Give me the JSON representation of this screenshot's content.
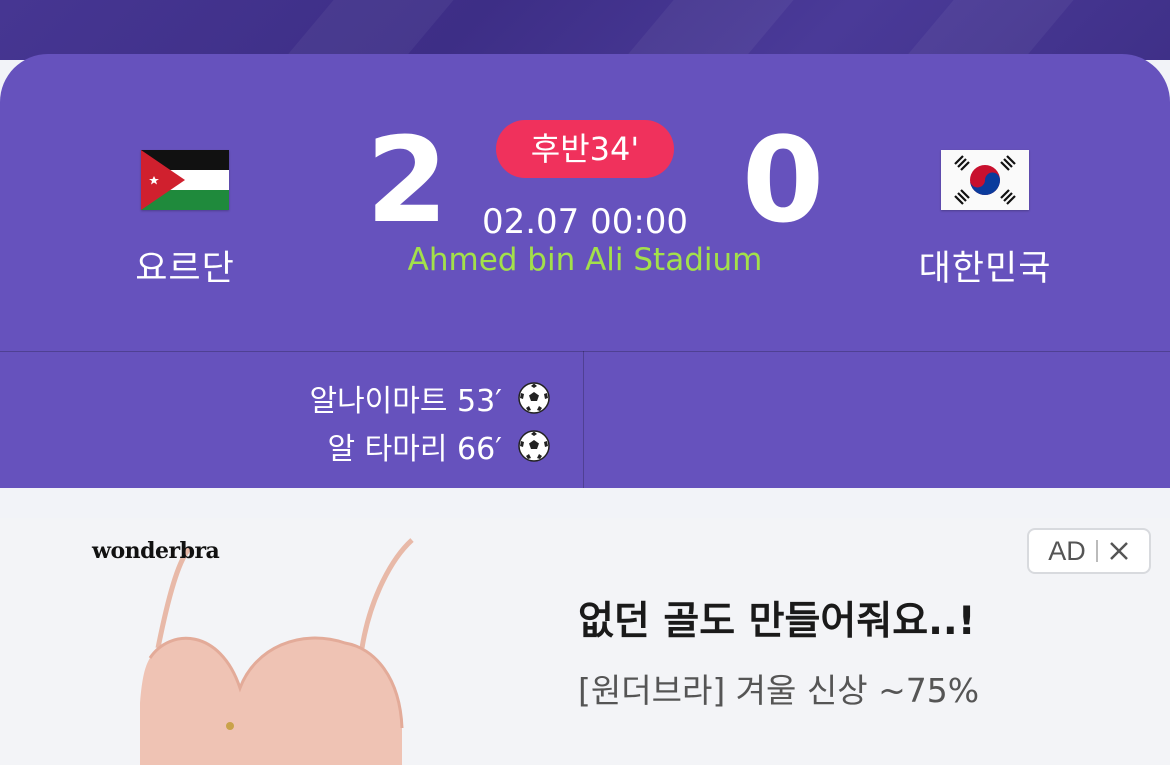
{
  "match": {
    "home": {
      "name": "요르단",
      "score": "2",
      "flag": "jordan-flag"
    },
    "away": {
      "name": "대한민국",
      "score": "0",
      "flag": "south-korea-flag"
    },
    "status": "후반34'",
    "datetime": "02.07 00:00",
    "stadium": "Ahmed bin Ali Stadium",
    "home_scorers": [
      {
        "text": "알나이마트 53′",
        "icon": "soccer-ball-icon"
      },
      {
        "text": "알 타마리 66′",
        "icon": "soccer-ball-icon"
      }
    ]
  },
  "ad": {
    "brand": "wonderbra",
    "badge_label": "AD",
    "close_icon": "close-icon",
    "title": "없던 골도 만들어줘요..!",
    "subtitle": "[원더브라] 겨울 신상 ~75%"
  },
  "colors": {
    "card": "#6652bd",
    "live_badge": "#f0315c",
    "stadium_text": "#a3e04a"
  }
}
